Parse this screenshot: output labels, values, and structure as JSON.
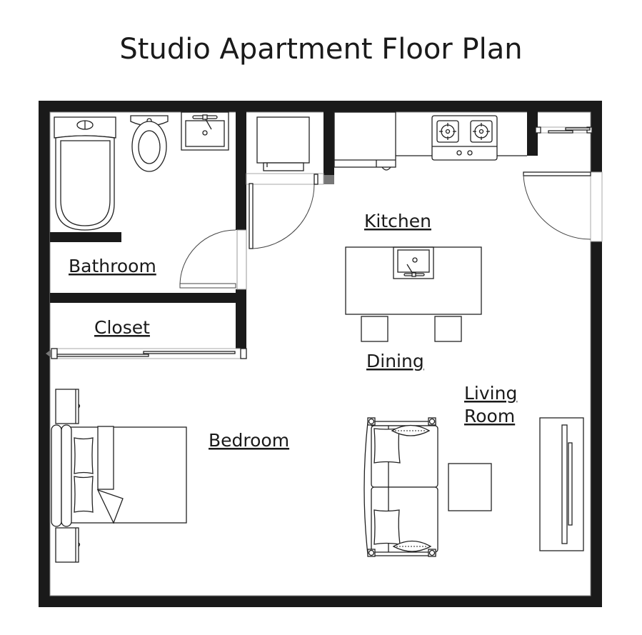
{
  "title": "Studio Apartment Floor Plan",
  "rooms": {
    "bathroom": "Bathroom",
    "closet": "Closet",
    "kitchen": "Kitchen",
    "dining": "Dining",
    "living_line1": "Living",
    "living_line2": "Room",
    "bedroom": "Bedroom"
  },
  "fixtures": {
    "bathroom": [
      "bathtub",
      "toilet",
      "bathroom-sink"
    ],
    "kitchen": [
      "refrigerator",
      "dishwasher",
      "cooktop-2-burner",
      "island-sink"
    ],
    "dining": [
      "stool",
      "stool"
    ],
    "living": [
      "sofa",
      "coffee-table",
      "tv-console"
    ],
    "bedroom": [
      "bed",
      "nightstand",
      "nightstand"
    ],
    "closet": [
      "sliding-door"
    ]
  },
  "colors": {
    "wall": "#1a1a1a",
    "line": "#222222",
    "background": "#ffffff"
  }
}
